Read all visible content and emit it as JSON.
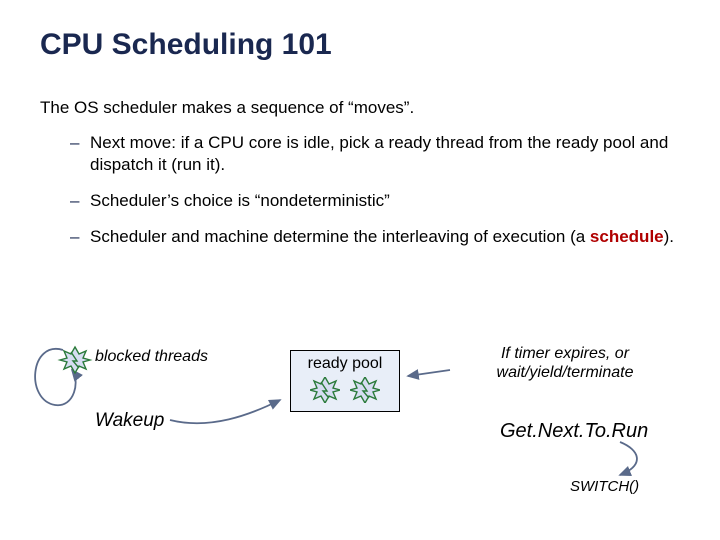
{
  "title": "CPU Scheduling 101",
  "intro": "The OS scheduler makes a sequence of “moves”.",
  "bullets": {
    "b1": "Next move: if a CPU core is idle, pick a ready thread from the ready pool and dispatch it (run it).",
    "b2": "Scheduler’s choice is “nondeterministic”",
    "b3a": "Scheduler and machine determine the interleaving of execution (a ",
    "b3b": "schedule",
    "b3c": ")."
  },
  "diagram": {
    "blocked": "blocked threads",
    "wakeup": "Wakeup",
    "ready_pool": "ready pool",
    "right_caption": "If timer expires, or wait/yield/terminate",
    "getnext": "Get.Next.To.Run",
    "switch": "SWITCH()"
  },
  "icons": {
    "thread": "thread-icon",
    "arrow": "arrow-icon"
  },
  "colors": {
    "title": "#1a2850",
    "accent_red": "#b00000",
    "burst_fill": "#d6ddf2",
    "burst_stroke": "#2a7a3a",
    "ready_fill": "#e8eef8"
  }
}
